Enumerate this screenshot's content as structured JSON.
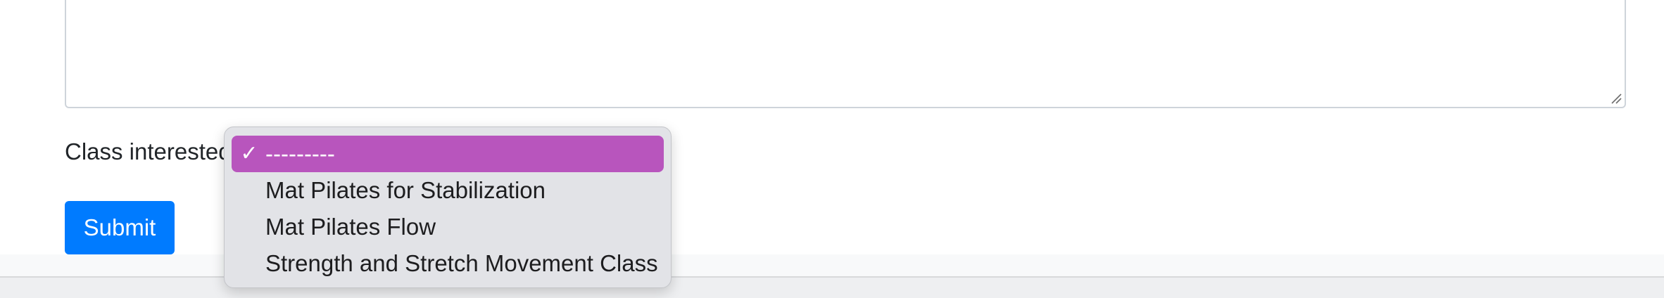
{
  "form": {
    "class_label": "Class interested",
    "submit_label": "Submit"
  },
  "dropdown": {
    "selected_index": 0,
    "checkmark": "✓",
    "highlight_color": "#b855bd",
    "options": [
      {
        "label": "---------"
      },
      {
        "label": "Mat Pilates for Stabilization"
      },
      {
        "label": "Mat Pilates Flow"
      },
      {
        "label": "Strength and Stretch Movement Class"
      }
    ]
  },
  "colors": {
    "primary_button": "#007bff"
  },
  "icons": {
    "resize_grip": "resize-grip-icon",
    "check": "checkmark-icon"
  }
}
